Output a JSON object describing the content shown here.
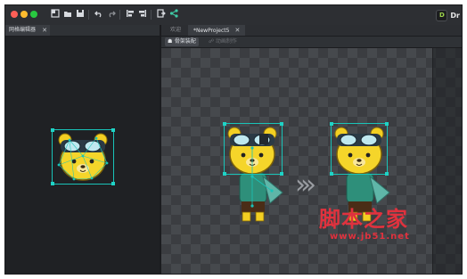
{
  "toolbar": {
    "buttons": [
      "new-file-icon",
      "open-folder-icon",
      "save-icon",
      "undo-icon",
      "redo-icon",
      "align-left-icon",
      "align-right-icon",
      "export-icon",
      "share-icon"
    ],
    "brand_label": "Dr",
    "brand_logo": "D"
  },
  "left_panel": {
    "tab_label": "网格编辑器",
    "close_glyph": "✕"
  },
  "right_panel": {
    "tabs": [
      {
        "label": "欢迎",
        "active": false
      },
      {
        "label": "*NewProject5",
        "active": true
      }
    ],
    "close_glyph": "✕",
    "modes": [
      {
        "label": "骨架装配",
        "active": true
      },
      {
        "label": "动画制作",
        "active": false
      }
    ],
    "arrow_glyphs": "›››"
  },
  "watermark": {
    "cn": "脚本之家",
    "url": "www.jb51.net"
  },
  "colors": {
    "accent_bone": "#19c3b8",
    "character_body": "#f5d52a",
    "sweater": "#2e8f7a",
    "watermark": "#e0323e"
  }
}
